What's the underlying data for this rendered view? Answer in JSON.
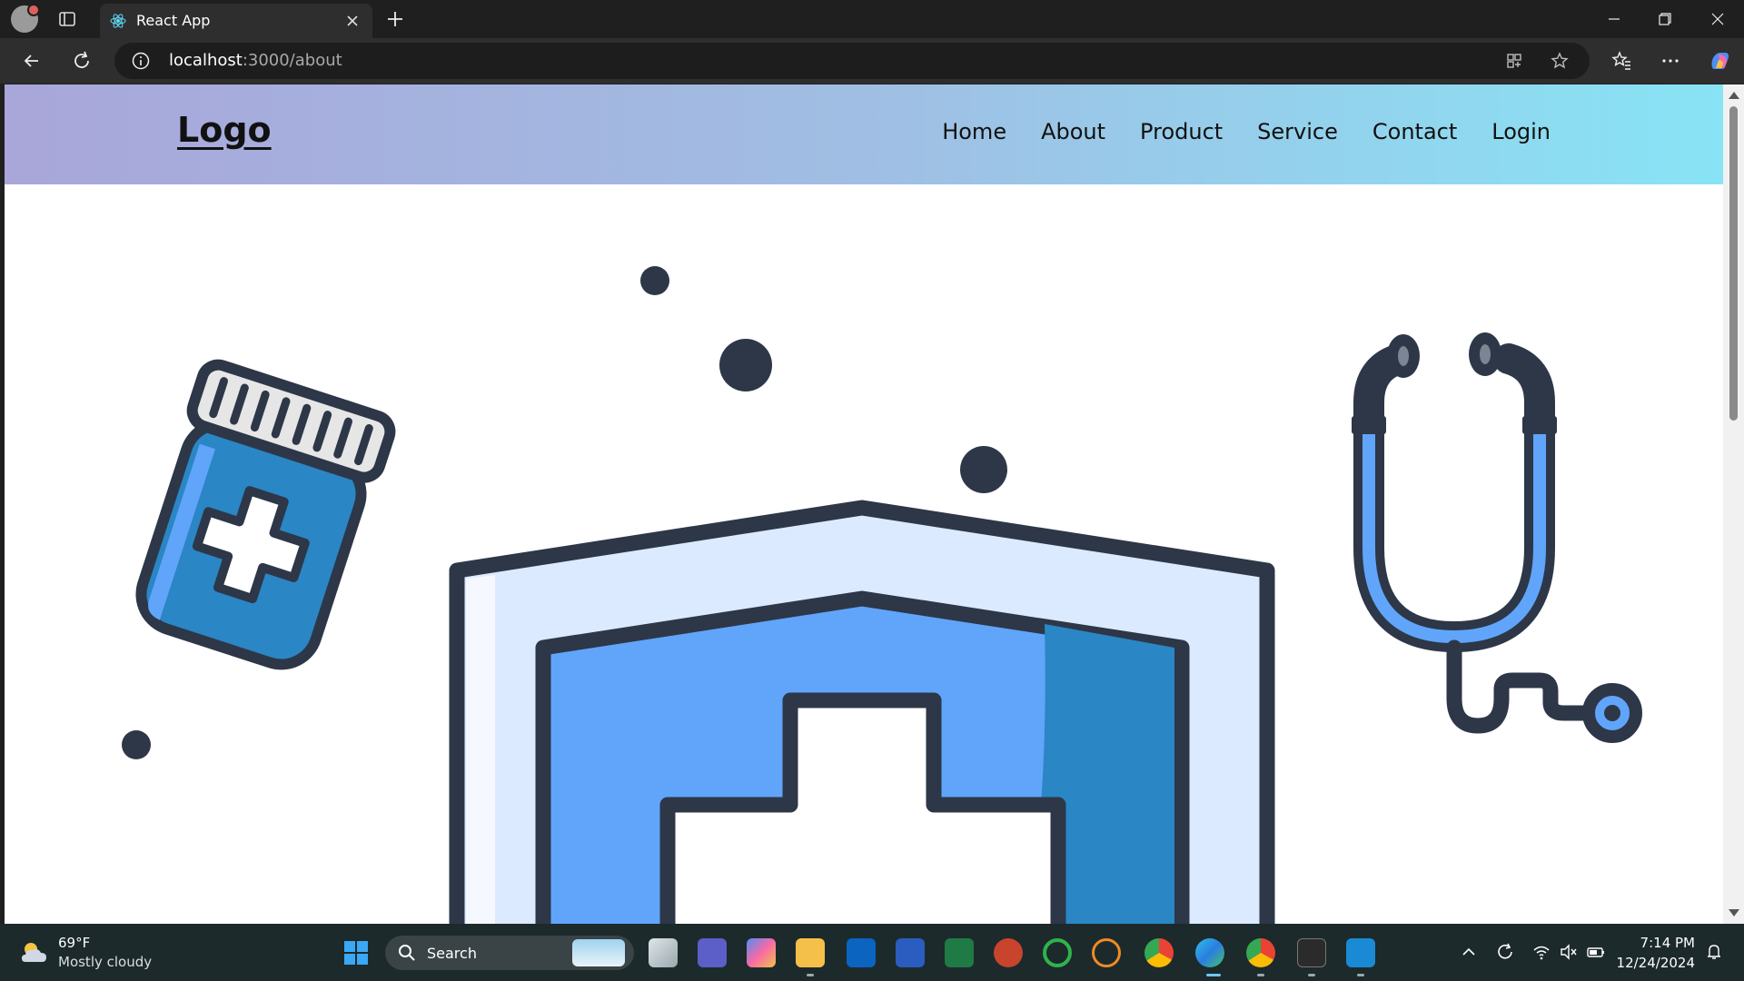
{
  "browser": {
    "tab_title": "React App",
    "url_host": "localhost",
    "url_path": ":3000/about"
  },
  "site": {
    "logo": "Logo",
    "nav": [
      "Home",
      "About",
      "Product",
      "Service",
      "Contact",
      "Login"
    ]
  },
  "illustration": {
    "theme": "medical",
    "elements": [
      "pill-bottle",
      "shield-with-cross",
      "stethoscope",
      "decorative-dots"
    ],
    "colors": {
      "outline": "#2d3748",
      "blue": "#60a5fa",
      "dark_blue": "#2a86c4",
      "light_blue": "#dbeafe",
      "cap": "#e6e6e6"
    }
  },
  "taskbar": {
    "weather_temp": "69°F",
    "weather_desc": "Mostly cloudy",
    "search_placeholder": "Search",
    "time": "7:14 PM",
    "date": "12/24/2024",
    "apps": [
      "file-explorer-task-view",
      "teams",
      "copilot",
      "file-explorer",
      "outlook",
      "word",
      "excel",
      "powerpoint",
      "loading-app",
      "arc-app",
      "chrome",
      "edge",
      "chrome-profile",
      "terminal",
      "vscode"
    ]
  },
  "colors": {
    "header_gradient_start": "#a9a6da",
    "header_gradient_end": "#88e3f5",
    "browser_chrome": "#1f1f1f",
    "taskbar": "#1c2a2c"
  }
}
